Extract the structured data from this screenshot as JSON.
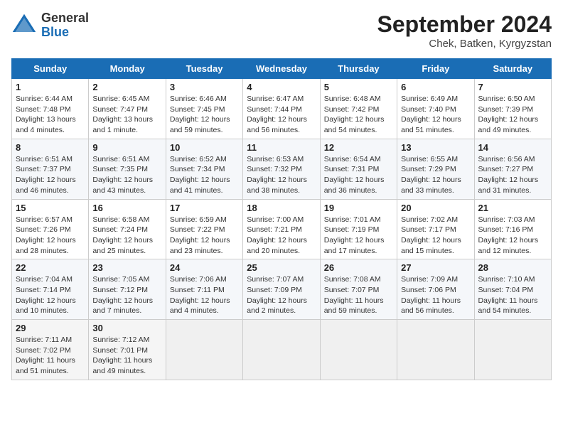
{
  "header": {
    "logo_line1": "General",
    "logo_line2": "Blue",
    "month": "September 2024",
    "location": "Chek, Batken, Kyrgyzstan"
  },
  "columns": [
    "Sunday",
    "Monday",
    "Tuesday",
    "Wednesday",
    "Thursday",
    "Friday",
    "Saturday"
  ],
  "weeks": [
    [
      {
        "day": "1",
        "info": "Sunrise: 6:44 AM\nSunset: 7:48 PM\nDaylight: 13 hours\nand 4 minutes."
      },
      {
        "day": "2",
        "info": "Sunrise: 6:45 AM\nSunset: 7:47 PM\nDaylight: 13 hours\nand 1 minute."
      },
      {
        "day": "3",
        "info": "Sunrise: 6:46 AM\nSunset: 7:45 PM\nDaylight: 12 hours\nand 59 minutes."
      },
      {
        "day": "4",
        "info": "Sunrise: 6:47 AM\nSunset: 7:44 PM\nDaylight: 12 hours\nand 56 minutes."
      },
      {
        "day": "5",
        "info": "Sunrise: 6:48 AM\nSunset: 7:42 PM\nDaylight: 12 hours\nand 54 minutes."
      },
      {
        "day": "6",
        "info": "Sunrise: 6:49 AM\nSunset: 7:40 PM\nDaylight: 12 hours\nand 51 minutes."
      },
      {
        "day": "7",
        "info": "Sunrise: 6:50 AM\nSunset: 7:39 PM\nDaylight: 12 hours\nand 49 minutes."
      }
    ],
    [
      {
        "day": "8",
        "info": "Sunrise: 6:51 AM\nSunset: 7:37 PM\nDaylight: 12 hours\nand 46 minutes."
      },
      {
        "day": "9",
        "info": "Sunrise: 6:51 AM\nSunset: 7:35 PM\nDaylight: 12 hours\nand 43 minutes."
      },
      {
        "day": "10",
        "info": "Sunrise: 6:52 AM\nSunset: 7:34 PM\nDaylight: 12 hours\nand 41 minutes."
      },
      {
        "day": "11",
        "info": "Sunrise: 6:53 AM\nSunset: 7:32 PM\nDaylight: 12 hours\nand 38 minutes."
      },
      {
        "day": "12",
        "info": "Sunrise: 6:54 AM\nSunset: 7:31 PM\nDaylight: 12 hours\nand 36 minutes."
      },
      {
        "day": "13",
        "info": "Sunrise: 6:55 AM\nSunset: 7:29 PM\nDaylight: 12 hours\nand 33 minutes."
      },
      {
        "day": "14",
        "info": "Sunrise: 6:56 AM\nSunset: 7:27 PM\nDaylight: 12 hours\nand 31 minutes."
      }
    ],
    [
      {
        "day": "15",
        "info": "Sunrise: 6:57 AM\nSunset: 7:26 PM\nDaylight: 12 hours\nand 28 minutes."
      },
      {
        "day": "16",
        "info": "Sunrise: 6:58 AM\nSunset: 7:24 PM\nDaylight: 12 hours\nand 25 minutes."
      },
      {
        "day": "17",
        "info": "Sunrise: 6:59 AM\nSunset: 7:22 PM\nDaylight: 12 hours\nand 23 minutes."
      },
      {
        "day": "18",
        "info": "Sunrise: 7:00 AM\nSunset: 7:21 PM\nDaylight: 12 hours\nand 20 minutes."
      },
      {
        "day": "19",
        "info": "Sunrise: 7:01 AM\nSunset: 7:19 PM\nDaylight: 12 hours\nand 17 minutes."
      },
      {
        "day": "20",
        "info": "Sunrise: 7:02 AM\nSunset: 7:17 PM\nDaylight: 12 hours\nand 15 minutes."
      },
      {
        "day": "21",
        "info": "Sunrise: 7:03 AM\nSunset: 7:16 PM\nDaylight: 12 hours\nand 12 minutes."
      }
    ],
    [
      {
        "day": "22",
        "info": "Sunrise: 7:04 AM\nSunset: 7:14 PM\nDaylight: 12 hours\nand 10 minutes."
      },
      {
        "day": "23",
        "info": "Sunrise: 7:05 AM\nSunset: 7:12 PM\nDaylight: 12 hours\nand 7 minutes."
      },
      {
        "day": "24",
        "info": "Sunrise: 7:06 AM\nSunset: 7:11 PM\nDaylight: 12 hours\nand 4 minutes."
      },
      {
        "day": "25",
        "info": "Sunrise: 7:07 AM\nSunset: 7:09 PM\nDaylight: 12 hours\nand 2 minutes."
      },
      {
        "day": "26",
        "info": "Sunrise: 7:08 AM\nSunset: 7:07 PM\nDaylight: 11 hours\nand 59 minutes."
      },
      {
        "day": "27",
        "info": "Sunrise: 7:09 AM\nSunset: 7:06 PM\nDaylight: 11 hours\nand 56 minutes."
      },
      {
        "day": "28",
        "info": "Sunrise: 7:10 AM\nSunset: 7:04 PM\nDaylight: 11 hours\nand 54 minutes."
      }
    ],
    [
      {
        "day": "29",
        "info": "Sunrise: 7:11 AM\nSunset: 7:02 PM\nDaylight: 11 hours\nand 51 minutes."
      },
      {
        "day": "30",
        "info": "Sunrise: 7:12 AM\nSunset: 7:01 PM\nDaylight: 11 hours\nand 49 minutes."
      },
      {
        "day": "",
        "info": ""
      },
      {
        "day": "",
        "info": ""
      },
      {
        "day": "",
        "info": ""
      },
      {
        "day": "",
        "info": ""
      },
      {
        "day": "",
        "info": ""
      }
    ]
  ]
}
